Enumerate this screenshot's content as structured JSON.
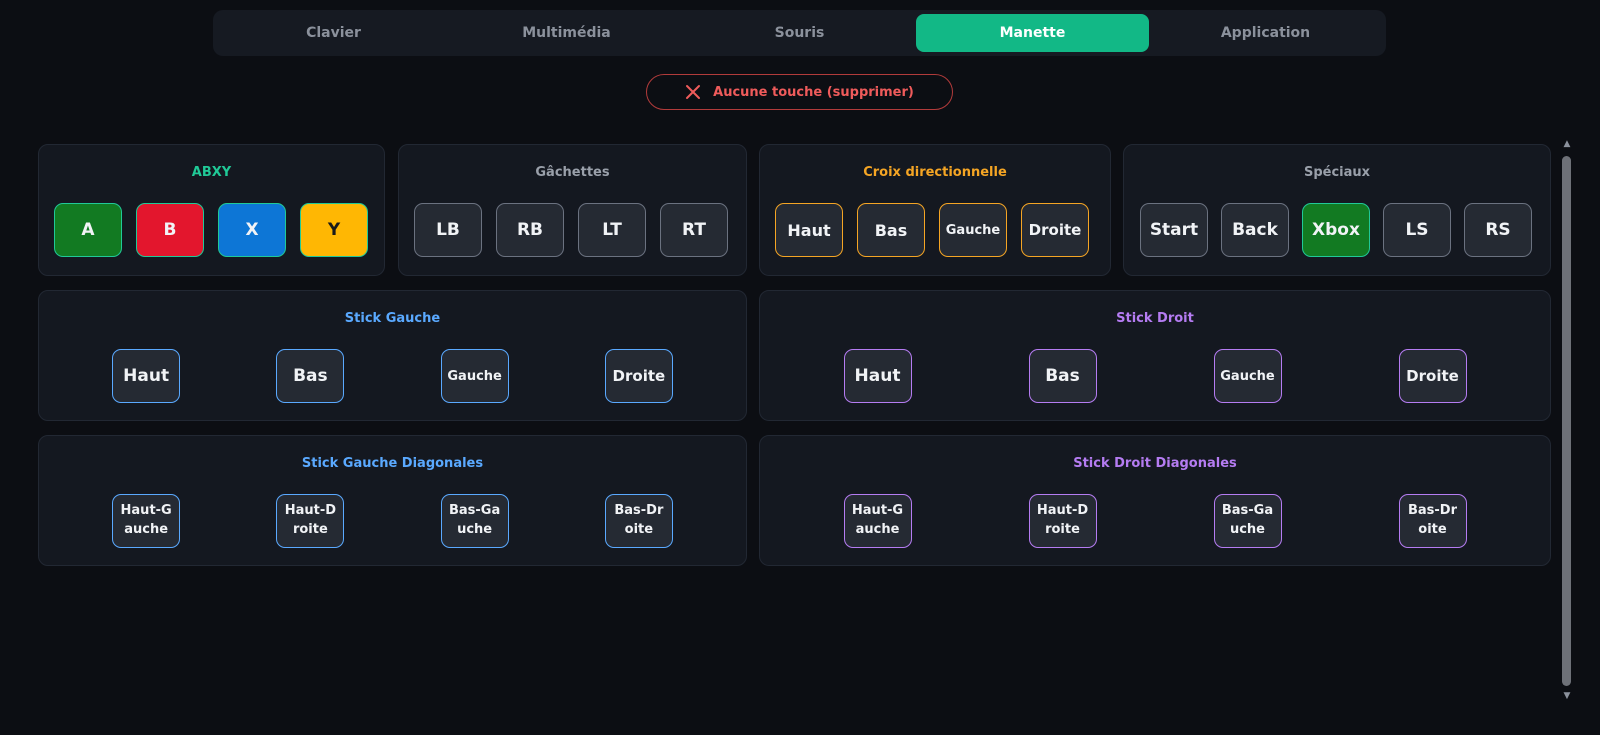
{
  "tabs": [
    "Clavier",
    "Multimédia",
    "Souris",
    "Manette",
    "Application"
  ],
  "active_tab": "Manette",
  "delete_button": {
    "label": "Aucune touche (supprimer)",
    "icon": "close-icon",
    "color": "#ef5b5b"
  },
  "groups": {
    "abxy": {
      "title": "ABXY",
      "title_color": "#20c997",
      "keys": [
        {
          "label": "A",
          "bg": "#127a22",
          "border": "#20c997"
        },
        {
          "label": "B",
          "bg": "#e3162d",
          "border": "#20c997"
        },
        {
          "label": "X",
          "bg": "#0d76d6",
          "border": "#20c997"
        },
        {
          "label": "Y",
          "bg": "#ffb703",
          "border": "#20c997",
          "text": "#1a1a1a"
        }
      ]
    },
    "triggers": {
      "title": "Gâchettes",
      "title_color": "#9aa0aa",
      "keys": [
        {
          "label": "LB"
        },
        {
          "label": "RB"
        },
        {
          "label": "LT"
        },
        {
          "label": "RT"
        }
      ]
    },
    "dpad": {
      "title": "Croix directionnelle",
      "title_color": "#f5a524",
      "key_border": "#f5a524",
      "keys": [
        {
          "label": "Haut"
        },
        {
          "label": "Bas"
        },
        {
          "label": "Gauche"
        },
        {
          "label": "Droite"
        }
      ]
    },
    "special": {
      "title": "Spéciaux",
      "title_color": "#9aa0aa",
      "keys": [
        {
          "label": "Start"
        },
        {
          "label": "Back"
        },
        {
          "label": "Xbox",
          "bg": "#127a22",
          "border": "#20c997"
        },
        {
          "label": "LS"
        },
        {
          "label": "RS"
        }
      ]
    },
    "left_stick": {
      "title": "Stick Gauche",
      "title_color": "#5aa9ff",
      "key_border": "#5aa9ff",
      "keys": [
        {
          "label": "Haut"
        },
        {
          "label": "Bas"
        },
        {
          "label": "Gauche"
        },
        {
          "label": "Droite"
        }
      ]
    },
    "right_stick": {
      "title": "Stick Droit",
      "title_color": "#b57cf2",
      "key_border": "#b57cf2",
      "keys": [
        {
          "label": "Haut"
        },
        {
          "label": "Bas"
        },
        {
          "label": "Gauche"
        },
        {
          "label": "Droite"
        }
      ]
    },
    "left_diag": {
      "title": "Stick Gauche Diagonales",
      "title_color": "#5aa9ff",
      "key_border": "#5aa9ff",
      "keys": [
        {
          "label": "Haut-G\nauche"
        },
        {
          "label": "Haut-D\nroite"
        },
        {
          "label": "Bas-Ga\nuche"
        },
        {
          "label": "Bas-Dr\noite"
        }
      ]
    },
    "right_diag": {
      "title": "Stick Droit Diagonales",
      "title_color": "#b57cf2",
      "key_border": "#b57cf2",
      "keys": [
        {
          "label": "Haut-G\nauche"
        },
        {
          "label": "Haut-D\nroite"
        },
        {
          "label": "Bas-Ga\nuche"
        },
        {
          "label": "Bas-Dr\noite"
        }
      ]
    }
  }
}
